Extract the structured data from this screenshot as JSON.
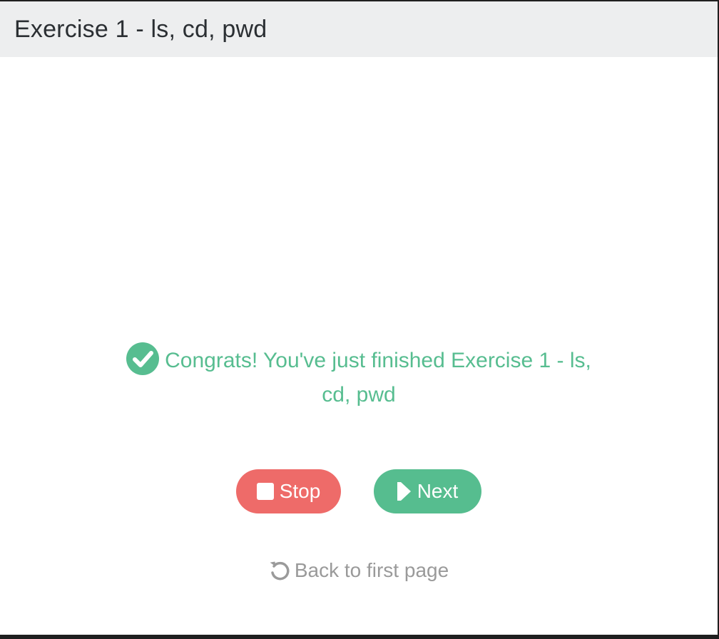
{
  "header": {
    "title": "Exercise 1 - ls, cd, pwd"
  },
  "completion": {
    "message": "Congrats! You've just finished Exercise 1 - ls, cd, pwd",
    "icon": "check-circle-icon",
    "color": "#57bd90"
  },
  "actions": {
    "stop_label": "Stop",
    "stop_icon": "stop-square-icon",
    "stop_color": "#ee6b69",
    "next_label": "Next",
    "next_icon": "step-forward-icon",
    "next_color": "#56bd8f"
  },
  "footer": {
    "back_label": "Back to first page",
    "back_icon": "undo-arrow-icon"
  }
}
